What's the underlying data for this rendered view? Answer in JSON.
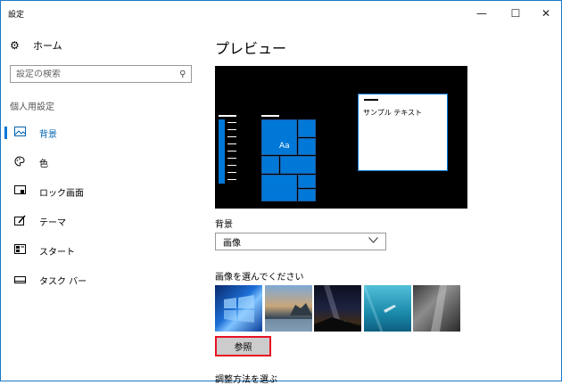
{
  "window": {
    "title": "設定"
  },
  "controls": {
    "minimize": "—",
    "maximize": "☐",
    "close": "✕"
  },
  "sidebar": {
    "home_label": "ホーム",
    "search_placeholder": "設定の検索",
    "section_label": "個人用設定",
    "items": [
      {
        "label": "背景",
        "icon": "picture-icon",
        "active": true
      },
      {
        "label": "色",
        "icon": "palette-icon",
        "active": false
      },
      {
        "label": "ロック画面",
        "icon": "lock-screen-icon",
        "active": false
      },
      {
        "label": "テーマ",
        "icon": "theme-icon",
        "active": false
      },
      {
        "label": "スタート",
        "icon": "start-icon",
        "active": false
      },
      {
        "label": "タスク バー",
        "icon": "taskbar-icon",
        "active": false
      }
    ]
  },
  "main": {
    "heading": "プレビュー",
    "preview": {
      "sample_text": "サンプル テキスト",
      "tile_text": "Aa"
    },
    "background_label": "背景",
    "background_value": "画像",
    "choose_label": "画像を選んでください",
    "thumbnails": [
      "windows-hero",
      "beach-sunset",
      "night-sky",
      "underwater-swimmer",
      "rock-cliff"
    ],
    "browse_button": "参照",
    "fit_label": "調整方法を選ぶ"
  },
  "colors": {
    "accent": "#0078d7",
    "highlight": "#e81123"
  }
}
